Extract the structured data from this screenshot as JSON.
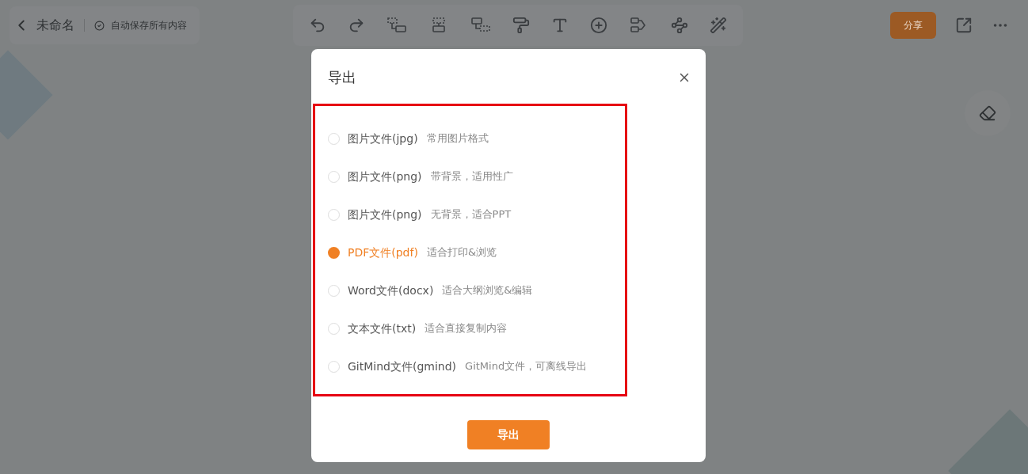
{
  "header": {
    "title": "未命名",
    "autosave": "自动保存所有内容",
    "share_button": "分享"
  },
  "dialog": {
    "title": "导出",
    "options": [
      {
        "label": "图片文件(jpg)",
        "description": "常用图片格式",
        "selected": false
      },
      {
        "label": "图片文件(png)",
        "description": "带背景，适用性广",
        "selected": false
      },
      {
        "label": "图片文件(png)",
        "description": "无背景，适合PPT",
        "selected": false
      },
      {
        "label": "PDF文件(pdf)",
        "description": "适合打印&浏览",
        "selected": true
      },
      {
        "label": "Word文件(docx)",
        "description": "适合大纲浏览&编辑",
        "selected": false
      },
      {
        "label": "文本文件(txt)",
        "description": "适合直接复制内容",
        "selected": false
      },
      {
        "label": "GitMind文件(gmind)",
        "description": "GitMind文件，可离线导出",
        "selected": false
      }
    ],
    "export_button": "导出"
  }
}
